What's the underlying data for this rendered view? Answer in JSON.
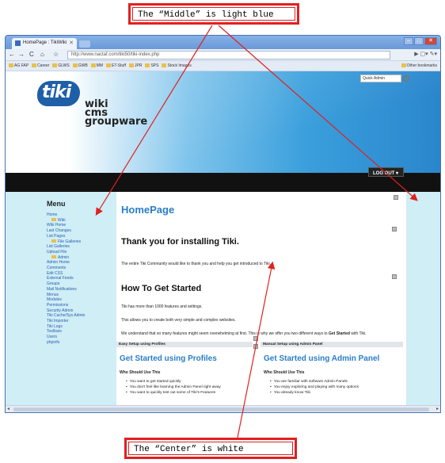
{
  "annotations": {
    "top_label": "The “Middle” is light blue",
    "bottom_label": "The “Center” is white"
  },
  "browser": {
    "tab_title": "HomePage : TikiWiki",
    "url": "http://www.nactaf.com/tiki50/tiki-index.php",
    "bookmarks": [
      "AG FAP",
      "Career",
      "GLWS",
      "GWB",
      "MM",
      "ET-Stuff",
      "JPR",
      "SPS",
      "Stock Images"
    ],
    "other_bookmarks": "Other bookmarks"
  },
  "header": {
    "logo_mark": "tiki",
    "logo_line1": "wiki",
    "logo_line2": "cms",
    "logo_line3": "groupware",
    "quick_admin": "Quick Admin",
    "logout": "LOG OUT"
  },
  "menu": {
    "title": "Menu",
    "items": [
      {
        "label": "Home",
        "folder": false
      },
      {
        "label": "Wiki",
        "folder": true
      },
      {
        "label": "Wiki Home",
        "folder": false
      },
      {
        "label": "Last Changes",
        "folder": false
      },
      {
        "label": "List Pages",
        "folder": false
      },
      {
        "label": "File Galleries",
        "folder": true
      },
      {
        "label": "List Galleries",
        "folder": false
      },
      {
        "label": "Upload File",
        "folder": false
      },
      {
        "label": "Admin",
        "folder": true
      },
      {
        "label": "Admin Home",
        "folder": false
      },
      {
        "label": "Comments",
        "folder": false
      },
      {
        "label": "Edit CSS",
        "folder": false
      },
      {
        "label": "External Feeds",
        "folder": false
      },
      {
        "label": "Groups",
        "folder": false
      },
      {
        "label": "Mail Notifications",
        "folder": false
      },
      {
        "label": "Menus",
        "folder": false
      },
      {
        "label": "Modules",
        "folder": false
      },
      {
        "label": "Permissions",
        "folder": false
      },
      {
        "label": "Security Admin",
        "folder": false
      },
      {
        "label": "Tiki Cache/Sys Admin",
        "folder": false
      },
      {
        "label": "Tiki Importer",
        "folder": false
      },
      {
        "label": "Tiki Logs",
        "folder": false
      },
      {
        "label": "Toolbars",
        "folder": false
      },
      {
        "label": "Users",
        "folder": false
      },
      {
        "label": "phpinfo",
        "folder": false
      }
    ]
  },
  "content": {
    "page_title": "HomePage",
    "thanks_heading": "Thank you for installing Tiki.",
    "thanks_text": "The entire Tiki Community would like to thank you and help you get introduced to Tiki.",
    "how_heading": "How To Get Started",
    "p1": "Tiki has more than 1000 features and settings.",
    "p2": "This allows you to create both very simple and complex websites.",
    "p3_start": "We understand that so many features might seem overwhelming at first. This is why we offer you two different ways to ",
    "p3_bold": "Get Started",
    "p3_end": " with Tiki.",
    "left_box": {
      "head": "Easy Setup using Profiles",
      "title": "Get Started using Profiles",
      "who": "Who Should Use This",
      "bullets": [
        "You want to get started quickly",
        "You don't feel like learning the Admin Panel right away",
        "You want to quickly test out some of Tiki's Features"
      ]
    },
    "right_box": {
      "head": "Manual Setup using Admin Panel",
      "title": "Get Started using Admin Panel",
      "who": "Who Should Use This",
      "bullets": [
        "You are familiar with software Admin Panels",
        "You enjoy exploring and playing with many options",
        "You already know Tiki"
      ]
    }
  }
}
